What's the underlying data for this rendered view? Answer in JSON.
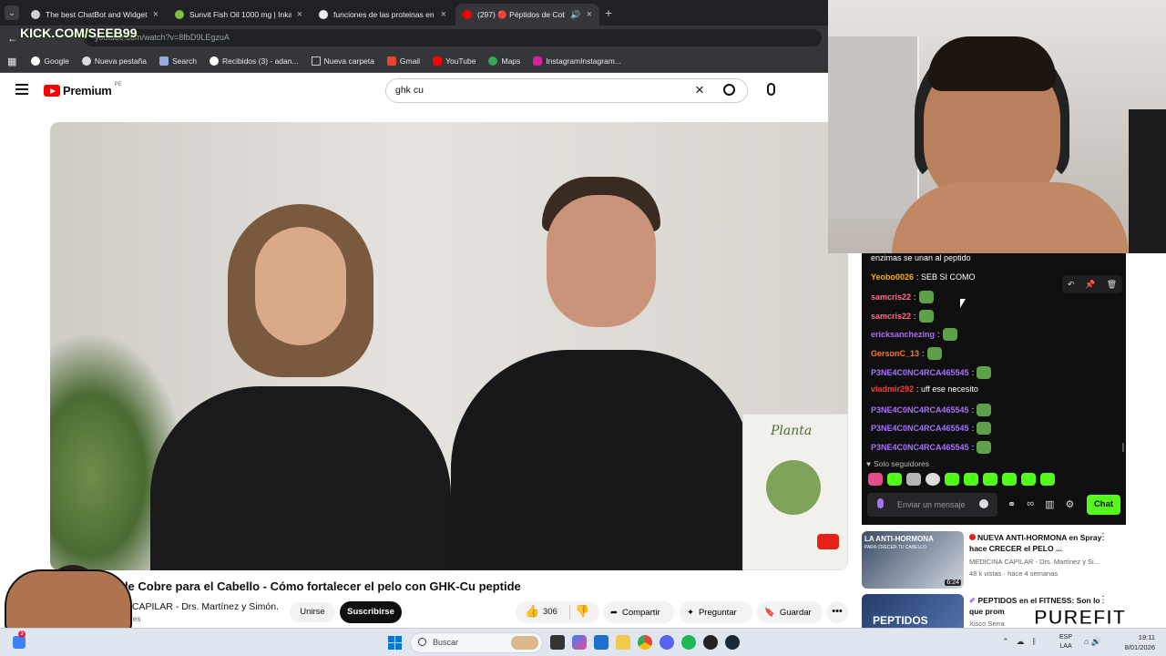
{
  "tabs": [
    {
      "title": "The best ChatBot and Widgets",
      "fav": "#cfcfcf"
    },
    {
      "title": "Sunvit Fish Oil 1000 mg | Inkafa",
      "fav": "#7bbf3a"
    },
    {
      "title": "funciones de las proteinas en el",
      "fav": "#e8eaed"
    },
    {
      "title": "(297) 🔴 Péptidos de Cobre",
      "fav": "#ff0000"
    }
  ],
  "address": {
    "url": "youtube.com/watch?v=8fbD9LEgzuA",
    "overlay": "KICK.COM/SEEB99"
  },
  "bookmarks": [
    "Google",
    "Nueva pestaña",
    "Search",
    "Recibidos (3) - adan...",
    "Nueva carpeta",
    "Gmail",
    "YouTube",
    "Maps",
    "InstagramInstagram..."
  ],
  "youtube": {
    "logo": "Premium",
    "region": "PE",
    "search_value": "ghk cu",
    "video_title": "ptidos de Cobre para el Cabello - Cómo fortalecer el pelo con GHK-Cu peptide",
    "channel": "EDICINA CAPILAR - Drs. Martínez y Simón.",
    "subs": "k suscriptores",
    "join": "Unirse",
    "subscribe": "Suscribirse",
    "likes": "306",
    "share": "Compartir",
    "ask": "Preguntar",
    "save": "Guardar",
    "player_badge": "Planta"
  },
  "chat": {
    "messages": [
      {
        "user": "",
        "text": "enzimas se unan al peptido",
        "color": "#ffffff",
        "emote": false
      },
      {
        "user": "Yeobo0026",
        "text": ": SEB SI COMO",
        "color": "#f5b400",
        "emote": false
      },
      {
        "user": "samcris22",
        "text": ":",
        "color": "#ff6b8a",
        "emote": true
      },
      {
        "user": "samcris22",
        "text": ":",
        "color": "#ff6b8a",
        "emote": true
      },
      {
        "user": "ericksanchezing",
        "text": ":",
        "color": "#b36bff",
        "emote": true
      },
      {
        "user": "GersonC_13",
        "text": ":",
        "color": "#ff7a1a",
        "emote": true
      },
      {
        "user": "P3NE4C0NC4RCA465545",
        "text": ":",
        "color": "#a970ff",
        "emote": true
      },
      {
        "user": "vladmir292",
        "text": ": uff ese necesito",
        "color": "#ff3b3b",
        "emote": false
      },
      {
        "user": "P3NE4C0NC4RCA465545",
        "text": ":",
        "color": "#a970ff",
        "emote": true
      },
      {
        "user": "P3NE4C0NC4RCA465545",
        "text": ":",
        "color": "#a970ff",
        "emote": true
      },
      {
        "user": "P3NE4C0NC4RCA465545",
        "text": ":",
        "color": "#a970ff",
        "emote": true
      }
    ],
    "followers_only": "Solo seguidores",
    "input_placeholder": "Enviar un mensaje",
    "chat_button": "Chat",
    "accent": "#53fc18"
  },
  "recommendations": [
    {
      "title": "NUEVA ANTI-HORMONA en Spray hace CRECER el PELO ...",
      "channel": "MEDICINA CAPILAR - Drs. Martínez y Si...",
      "meta": "48 k vistas · hace 4 semanas",
      "duration": "6:24",
      "thumb_text": "LA ANTI-HORMONA",
      "thumb_sub": "PARA CRECER TU CABELLO"
    },
    {
      "title": "PEPTIDOS en el FITNESS: Son lo que prom",
      "channel": "Xisco Serra",
      "meta": "",
      "duration": "",
      "thumb_text": "PEPTIDOS",
      "thumb_sub": ""
    }
  ],
  "watermark": "PUREFIT",
  "taskbar": {
    "search": "Buscar",
    "lang1": "ESP",
    "lang2": "LAA",
    "time": "19:11",
    "date": "8/01/2026"
  }
}
